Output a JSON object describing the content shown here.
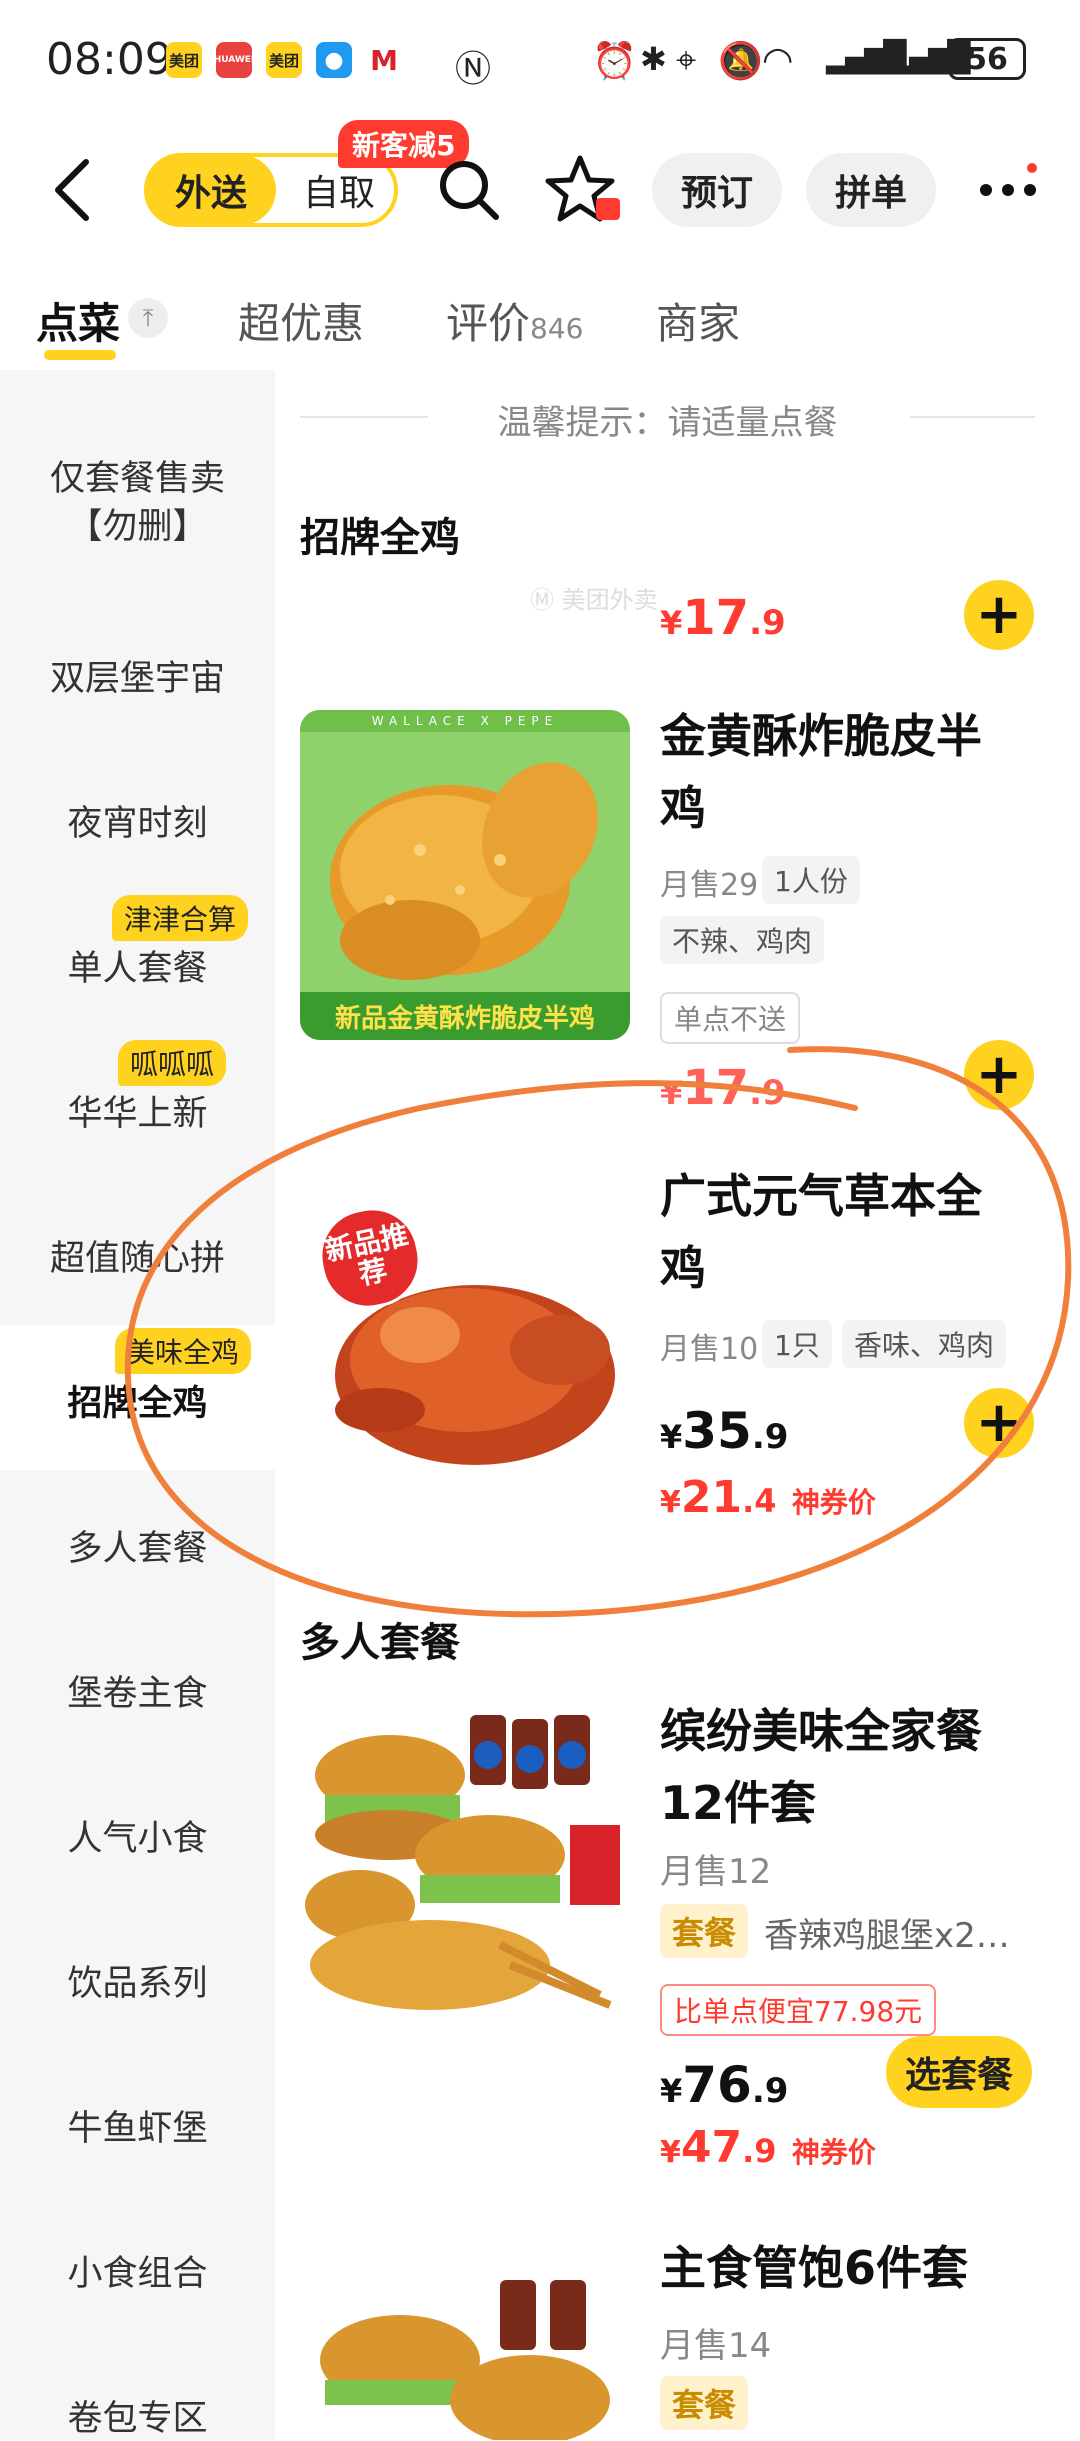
{
  "status_bar": {
    "time": "08:09",
    "app_icons": [
      "美团",
      "HUAWEI",
      "美团",
      "msg",
      "M"
    ],
    "battery": "56",
    "icons": [
      "nfc-icon",
      "alarm-icon",
      "bluetooth-icon",
      "location-icon",
      "mute-icon",
      "wifi-icon",
      "signal-icon",
      "signal-icon"
    ]
  },
  "header": {
    "mode_active": "外送",
    "mode_inactive": "自取",
    "promo_badge": "新客减5",
    "reserve_label": "预订",
    "group_label": "拼单",
    "more_icon": "⋯"
  },
  "tabs": [
    {
      "label": "点菜",
      "active": true
    },
    {
      "label": "超优惠",
      "active": false
    },
    {
      "label": "评价",
      "count": "846",
      "active": false
    },
    {
      "label": "商家",
      "active": false
    }
  ],
  "sidebar": {
    "items": [
      {
        "label": "仅套餐售卖\n【勿删】"
      },
      {
        "label": "双层堡宇宙"
      },
      {
        "label": "夜宵时刻"
      },
      {
        "label": "单人套餐",
        "tag": "津津合算"
      },
      {
        "label": "华华上新",
        "tag": "呱呱呱"
      },
      {
        "label": "超值随心拼"
      },
      {
        "label": "招牌全鸡",
        "tag": "美味全鸡",
        "active": true
      },
      {
        "label": "多人套餐"
      },
      {
        "label": "堡卷主食"
      },
      {
        "label": "人气小食"
      },
      {
        "label": "饮品系列"
      },
      {
        "label": "牛鱼虾堡"
      },
      {
        "label": "小食组合"
      },
      {
        "label": "卷包专区"
      }
    ]
  },
  "main": {
    "tip": "温馨提示：请适量点餐",
    "sections": [
      {
        "title": "招牌全鸡",
        "top_price_int": "17",
        "top_price_dec": ".9",
        "products": [
          {
            "name": "金黄酥炸脆皮半鸡",
            "monthly": "月售29",
            "portion": "1人份",
            "tags": "不辣、鸡肉",
            "note": "单点不送",
            "price_int": "17",
            "price_dec": ".9",
            "image_caption": "新品金黄酥炸脆皮半鸡",
            "image_banner": "WALLACE X PEPE"
          },
          {
            "name": "广式元气草本全鸡",
            "monthly": "月售10",
            "portion": "1只",
            "tags": "香味、鸡肉",
            "price_int": "35",
            "price_dec": ".9",
            "coupon_int": "21",
            "coupon_dec": ".4",
            "coupon_label": "神券价",
            "image_caption": "新品推荐"
          }
        ]
      },
      {
        "title": "多人套餐",
        "products": [
          {
            "name": "缤纷美味全家餐12件套",
            "monthly": "月售12",
            "set_tag": "套餐",
            "set_desc": "香辣鸡腿堡x2…",
            "savings": "比单点便宜77.98元",
            "price_int": "76",
            "price_dec": ".9",
            "coupon_int": "47",
            "coupon_dec": ".9",
            "coupon_label": "神券价",
            "select_label": "选套餐"
          },
          {
            "name": "主食管饱6件套",
            "monthly": "月售14",
            "set_tag": "套餐"
          }
        ]
      }
    ]
  },
  "colors": {
    "accent": "#ffd21f",
    "price_red": "#ff3b30",
    "annotation": "#f07f3c"
  }
}
